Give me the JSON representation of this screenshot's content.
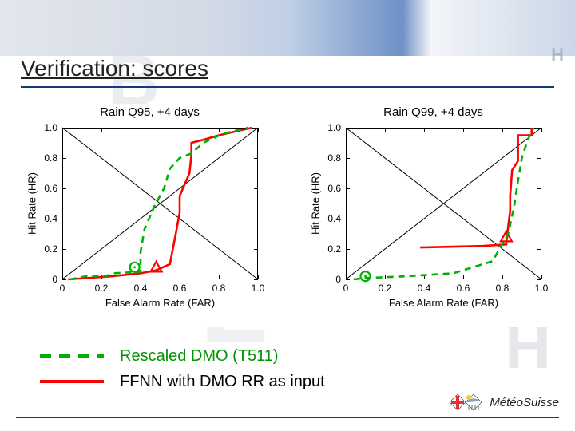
{
  "slide": {
    "title": "Verification: scores"
  },
  "legend": {
    "items": [
      {
        "label": "Rescaled DMO (T511)",
        "color": "#008000",
        "dashed": true
      },
      {
        "label": "FFNN with DMO RR as input",
        "color": "#ff0000",
        "dashed": false
      }
    ],
    "color_dmo": "#008000",
    "color_ffnn": "#222222"
  },
  "logo": {
    "text": "MétéoSuisse"
  },
  "chart_data": [
    {
      "type": "line",
      "title": "Rain Q95, +4 days",
      "xlabel": "False Alarm Rate (FAR)",
      "ylabel": "Hit Rate (HR)",
      "xlim": [
        0,
        1.0
      ],
      "ylim": [
        0,
        1.0
      ],
      "ticks_x": [
        0,
        0.2,
        0.4,
        0.6,
        0.8,
        1.0
      ],
      "ticks_y": [
        0,
        0.2,
        0.4,
        0.6,
        0.8,
        1.0
      ],
      "diagonals": true,
      "series": [
        {
          "name": "FFNN",
          "color": "#ff0000",
          "dashed": false,
          "points": [
            [
              0.03,
              0.0
            ],
            [
              0.25,
              0.02
            ],
            [
              0.4,
              0.04
            ],
            [
              0.48,
              0.06
            ],
            [
              0.55,
              0.1
            ],
            [
              0.58,
              0.3
            ],
            [
              0.6,
              0.44
            ],
            [
              0.6,
              0.55
            ],
            [
              0.65,
              0.7
            ],
            [
              0.66,
              0.82
            ],
            [
              0.66,
              0.9
            ],
            [
              0.72,
              0.92
            ],
            [
              0.8,
              0.95
            ],
            [
              0.97,
              1.0
            ]
          ],
          "marker": {
            "shape": "triangle",
            "point": [
              0.48,
              0.08
            ]
          }
        },
        {
          "name": "Rescaled DMO",
          "color": "#00b000",
          "dashed": true,
          "points": [
            [
              0.04,
              0.0
            ],
            [
              0.12,
              0.02
            ],
            [
              0.22,
              0.02
            ],
            [
              0.26,
              0.04
            ],
            [
              0.4,
              0.05
            ],
            [
              0.4,
              0.18
            ],
            [
              0.42,
              0.33
            ],
            [
              0.47,
              0.48
            ],
            [
              0.52,
              0.6
            ],
            [
              0.55,
              0.73
            ],
            [
              0.6,
              0.8
            ],
            [
              0.66,
              0.83
            ],
            [
              0.72,
              0.9
            ],
            [
              0.82,
              0.96
            ],
            [
              0.95,
              1.0
            ]
          ],
          "marker": {
            "shape": "circle",
            "point": [
              0.37,
              0.08
            ]
          }
        }
      ]
    },
    {
      "type": "line",
      "title": "Rain Q99, +4 days",
      "xlabel": "False Alarm Rate (FAR)",
      "ylabel": "Hit Rate (HR)",
      "xlim": [
        0,
        1.0
      ],
      "ylim": [
        0,
        1.0
      ],
      "ticks_x": [
        0,
        0.2,
        0.4,
        0.6,
        0.8,
        1.0
      ],
      "ticks_y": [
        0,
        0.2,
        0.4,
        0.6,
        0.8,
        1.0
      ],
      "diagonals": true,
      "series": [
        {
          "name": "FFNN",
          "color": "#ff0000",
          "dashed": false,
          "points": [
            [
              0.38,
              0.21
            ],
            [
              0.7,
              0.22
            ],
            [
              0.82,
              0.23
            ],
            [
              0.83,
              0.35
            ],
            [
              0.84,
              0.45
            ],
            [
              0.84,
              0.55
            ],
            [
              0.85,
              0.72
            ],
            [
              0.88,
              0.78
            ],
            [
              0.88,
              0.95
            ],
            [
              0.95,
              0.95
            ],
            [
              0.95,
              1.0
            ]
          ],
          "marker": {
            "shape": "triangle",
            "point": [
              0.82,
              0.28
            ]
          }
        },
        {
          "name": "Rescaled DMO",
          "color": "#00b000",
          "dashed": true,
          "points": [
            [
              0.04,
              0.0
            ],
            [
              0.12,
              0.01
            ],
            [
              0.3,
              0.02
            ],
            [
              0.55,
              0.04
            ],
            [
              0.75,
              0.12
            ],
            [
              0.83,
              0.3
            ],
            [
              0.86,
              0.48
            ],
            [
              0.88,
              0.65
            ],
            [
              0.9,
              0.8
            ],
            [
              0.93,
              0.92
            ],
            [
              0.96,
              1.0
            ]
          ],
          "marker": {
            "shape": "circle",
            "point": [
              0.1,
              0.02
            ]
          }
        }
      ]
    }
  ]
}
